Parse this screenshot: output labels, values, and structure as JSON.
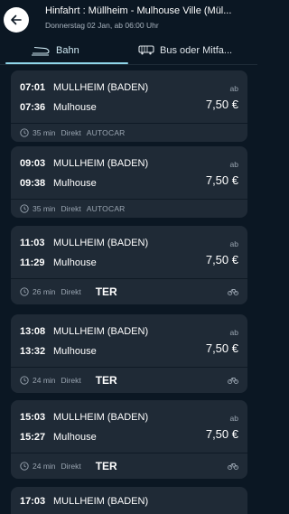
{
  "header": {
    "title": "Hinfahrt : Müllheim - Mulhouse Ville (Mül...",
    "subtitle": "Donnerstag 02 Jan, ab 06:00 Uhr"
  },
  "tabs": [
    {
      "label": "Bahn",
      "icon": "train-icon",
      "active": true
    },
    {
      "label": "Bus oder Mitfa...",
      "icon": "bus-icon",
      "active": false
    }
  ],
  "ab_label": "ab",
  "connections": [
    {
      "dep_time": "07:01",
      "dep_station": "MULLHEIM (BADEN)",
      "arr_time": "07:36",
      "arr_station": "Mulhouse",
      "price": "7,50 €",
      "duration": "35 min",
      "type": "Direkt",
      "operator": "AUTOCAR",
      "bike": false
    },
    {
      "dep_time": "09:03",
      "dep_station": "MULLHEIM (BADEN)",
      "arr_time": "09:38",
      "arr_station": "Mulhouse",
      "price": "7,50 €",
      "duration": "35 min",
      "type": "Direkt",
      "operator": "AUTOCAR",
      "bike": false
    },
    {
      "dep_time": "11:03",
      "dep_station": "MULLHEIM (BADEN)",
      "arr_time": "11:29",
      "arr_station": "Mulhouse",
      "price": "7,50 €",
      "duration": "26 min",
      "type": "Direkt",
      "operator": "TER",
      "bike": true
    },
    {
      "dep_time": "13:08",
      "dep_station": "MULLHEIM (BADEN)",
      "arr_time": "13:32",
      "arr_station": "Mulhouse",
      "price": "7,50 €",
      "duration": "24 min",
      "type": "Direkt",
      "operator": "TER",
      "bike": true
    },
    {
      "dep_time": "15:03",
      "dep_station": "MULLHEIM (BADEN)",
      "arr_time": "15:27",
      "arr_station": "Mulhouse",
      "price": "7,50 €",
      "duration": "24 min",
      "type": "Direkt",
      "operator": "TER",
      "bike": true
    },
    {
      "dep_time": "17:03",
      "dep_station": "MULLHEIM (BADEN)"
    }
  ]
}
